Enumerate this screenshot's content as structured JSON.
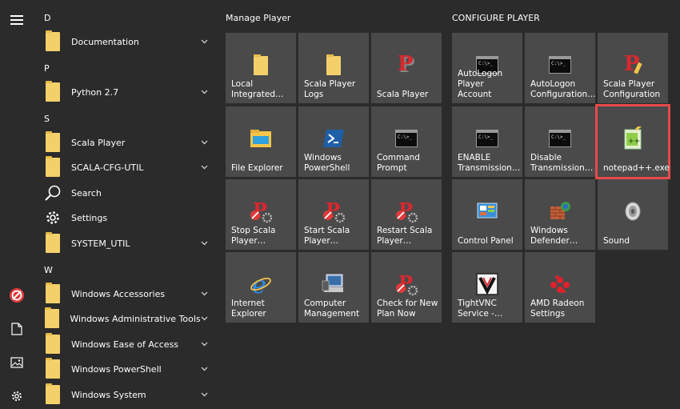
{
  "app_list": {
    "groups": [
      {
        "letter": "D",
        "items": [
          {
            "label": "Documentation",
            "icon": "folder-icon",
            "expandable": true
          }
        ]
      },
      {
        "letter": "P",
        "items": [
          {
            "label": "Python 2.7",
            "icon": "folder-icon",
            "expandable": true
          }
        ]
      },
      {
        "letter": "S",
        "items": [
          {
            "label": "Scala Player",
            "icon": "folder-icon",
            "expandable": true
          },
          {
            "label": "SCALA-CFG-UTIL",
            "icon": "folder-icon",
            "expandable": true
          },
          {
            "label": "Search",
            "icon": "search-icon",
            "expandable": false
          },
          {
            "label": "Settings",
            "icon": "gear-icon",
            "expandable": false
          },
          {
            "label": "SYSTEM_UTIL",
            "icon": "folder-icon",
            "expandable": true
          }
        ]
      },
      {
        "letter": "W",
        "items": [
          {
            "label": "Windows Accessories",
            "icon": "folder-icon",
            "expandable": true
          },
          {
            "label": "Windows Administrative Tools",
            "icon": "folder-icon",
            "expandable": true
          },
          {
            "label": "Windows Ease of Access",
            "icon": "folder-icon",
            "expandable": true
          },
          {
            "label": "Windows PowerShell",
            "icon": "folder-icon",
            "expandable": true
          },
          {
            "label": "Windows System",
            "icon": "folder-icon",
            "expandable": true
          }
        ]
      }
    ]
  },
  "groups": {
    "manage": {
      "title": "Manage Player",
      "tiles": [
        {
          "line1": "Local",
          "line2": "Integrated…",
          "icon": "folder-icon"
        },
        {
          "line1": "Scala Player",
          "line2": "Logs",
          "icon": "folder-icon"
        },
        {
          "line1": "Scala Player",
          "line2": "",
          "icon": "scala-player-icon"
        },
        {
          "line1": "File Explorer",
          "line2": "",
          "icon": "file-explorer-icon"
        },
        {
          "line1": "Windows",
          "line2": "PowerShell",
          "icon": "powershell-icon"
        },
        {
          "line1": "Command",
          "line2": "Prompt",
          "icon": "command-prompt-icon"
        },
        {
          "line1": "Stop Scala",
          "line2": "Player…",
          "icon": "scala-stop-icon"
        },
        {
          "line1": "Start Scala",
          "line2": "Player…",
          "icon": "scala-start-icon"
        },
        {
          "line1": "Restart Scala",
          "line2": "Player…",
          "icon": "scala-restart-icon"
        },
        {
          "line1": "Internet",
          "line2": "Explorer",
          "icon": "internet-explorer-icon"
        },
        {
          "line1": "Computer",
          "line2": "Management",
          "icon": "computer-management-icon"
        },
        {
          "line1": "Check for New",
          "line2": "Plan Now",
          "icon": "scala-check-plan-icon"
        }
      ]
    },
    "configure": {
      "title": "CONFIGURE PLAYER",
      "tiles": [
        {
          "line1": "AutoLogon",
          "line2": "Player Account",
          "icon": "command-prompt-icon"
        },
        {
          "line1": "AutoLogon",
          "line2": "Configuration…",
          "icon": "command-prompt-icon"
        },
        {
          "line1": "Scala Player",
          "line2": "Configuration",
          "icon": "scala-config-icon"
        },
        {
          "line1": "ENABLE",
          "line2": "Transmission…",
          "icon": "command-prompt-icon"
        },
        {
          "line1": "Disable",
          "line2": "Transmission…",
          "icon": "command-prompt-icon"
        },
        {
          "line1": "notepad++.exe",
          "line2": "",
          "icon": "notepad-plus-plus-icon",
          "selected": true
        },
        {
          "line1": "Control Panel",
          "line2": "",
          "icon": "control-panel-icon"
        },
        {
          "line1": "Windows",
          "line2": "Defender…",
          "icon": "windows-defender-icon"
        },
        {
          "line1": "Sound",
          "line2": "",
          "icon": "sound-icon"
        },
        {
          "line1": "TightVNC",
          "line2": "Service -…",
          "icon": "tightvnc-icon"
        },
        {
          "line1": "AMD Radeon",
          "line2": "Settings",
          "icon": "amd-radeon-icon"
        }
      ]
    }
  },
  "rail": {
    "items": [
      "hamburger-menu-icon",
      "scala-user-icon",
      "documents-icon",
      "pictures-icon",
      "settings-gear-icon"
    ]
  },
  "colors": {
    "background": "#2b2b2b",
    "tile": "#4a4a4a",
    "folder": "#f4d06a",
    "selection_outline": "#e84a4a",
    "scala_red": "#d9282f"
  }
}
